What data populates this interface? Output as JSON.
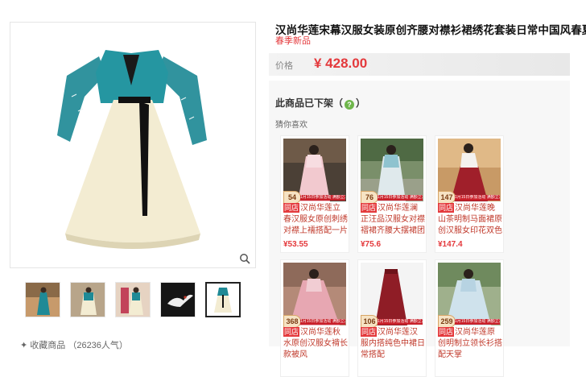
{
  "product": {
    "title": "汉尚华莲宋幕汉服女装原创齐腰对襟衫裙绣花套装日常中国风春夏款",
    "subtitle": "春季新品",
    "price_label": "价格",
    "price": "¥ 428.00"
  },
  "gallery": {
    "favorite_label": "✦ 收藏商品 （26236人气）"
  },
  "status": {
    "off_shelf_text": "此商品已下架",
    "off_shelf_paren_open": "（",
    "off_shelf_paren_close": "）",
    "help": "?"
  },
  "recommend": {
    "heading": "猜你喜欢",
    "tag": "同店",
    "items": [
      {
        "badge": "54",
        "strip": "1月15日参加活动 满额立减",
        "name": "汉尚华莲立春汉服女原创刺绣对襟上襦搭配一片式穿孔裙",
        "price": "¥53.55"
      },
      {
        "badge": "76",
        "strip": "1月15日参加活动 满额立减",
        "name": "汉尚华莲澜正汪品汉服女对襟褶裙齐腰大摆裙团花刺绣清",
        "price": "¥75.6"
      },
      {
        "badge": "147",
        "strip": "1月15日参加活动 满额立减",
        "name": "汉尚华莲晚山茶明制马面裙原创汉服女印花双色现货秋",
        "price": "¥147.4"
      },
      {
        "badge": "368",
        "strip": "1月15日参加活动 满额立减",
        "name": "汉尚华莲秋水原创汉服女褙长款被风",
        "price": ""
      },
      {
        "badge": "106",
        "strip": "1月15日参加活动 满额立减",
        "name": "汉尚华莲汉服内搭纯色中裙日常搭配",
        "price": ""
      },
      {
        "badge": "259",
        "strip": "1月15日参加活动 满额立减",
        "name": "汉尚华莲原创明制立领长衫搭配天掌",
        "price": ""
      }
    ]
  },
  "colors": {
    "accent": "#e4393c",
    "teal": "#1f8a96",
    "cream": "#f3ecd2"
  }
}
